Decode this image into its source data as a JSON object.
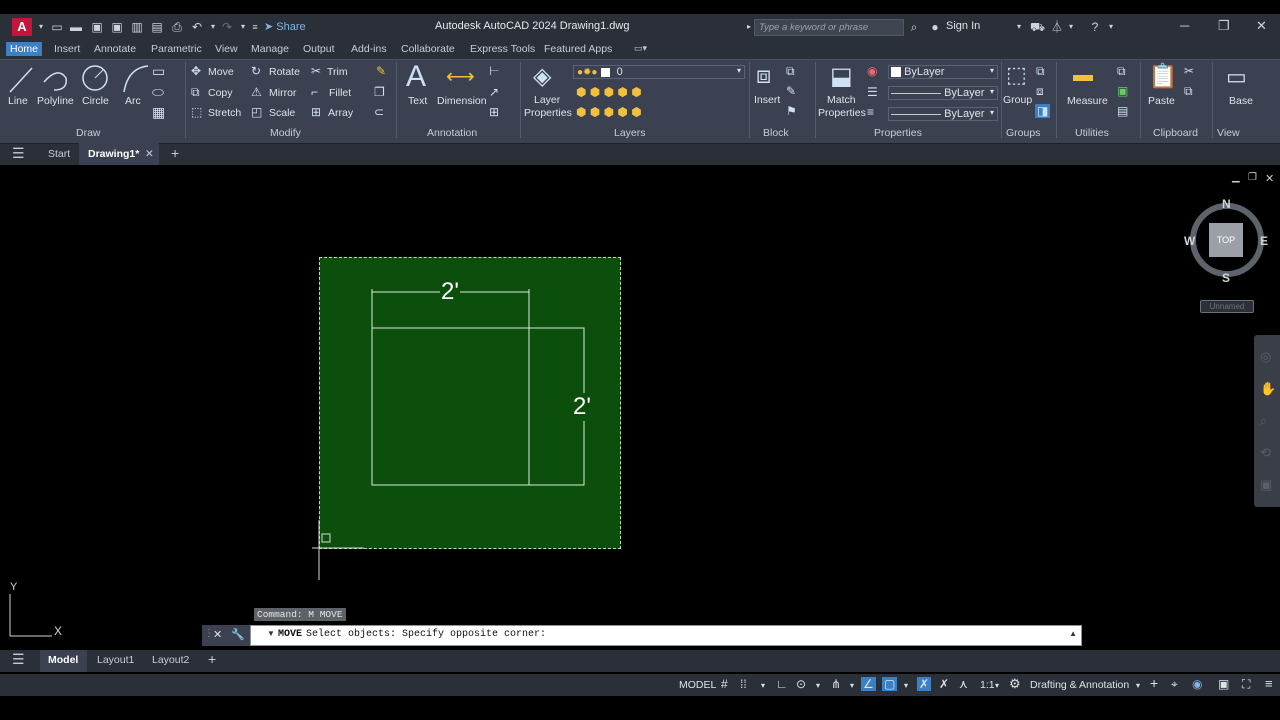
{
  "app": {
    "button_letter": "A",
    "share_label": "Share",
    "title": "Autodesk AutoCAD 2024   Drawing1.dwg",
    "search_placeholder": "Type a keyword or phrase",
    "signin_label": "Sign In"
  },
  "ribbon_tabs": [
    "Home",
    "Insert",
    "Annotate",
    "Parametric",
    "View",
    "Manage",
    "Output",
    "Add-ins",
    "Collaborate",
    "Express Tools",
    "Featured Apps"
  ],
  "draw": {
    "line": "Line",
    "polyline": "Polyline",
    "circle": "Circle",
    "arc": "Arc",
    "panel": "Draw"
  },
  "modify": {
    "move": "Move",
    "rotate": "Rotate",
    "trim": "Trim",
    "copy": "Copy",
    "mirror": "Mirror",
    "fillet": "Fillet",
    "stretch": "Stretch",
    "scale": "Scale",
    "array": "Array",
    "panel": "Modify"
  },
  "annotation": {
    "text": "Text",
    "dimension": "Dimension",
    "panel": "Annotation"
  },
  "layers": {
    "layer_properties_1": "Layer",
    "layer_properties_2": "Properties",
    "current_layer": "0",
    "panel": "Layers"
  },
  "block": {
    "insert": "Insert",
    "panel": "Block"
  },
  "properties": {
    "match_1": "Match",
    "match_2": "Properties",
    "color": "ByLayer",
    "linetype": "ByLayer",
    "lineweight": "ByLayer",
    "panel": "Properties"
  },
  "groups": {
    "group": "Group",
    "panel": "Groups"
  },
  "utilities": {
    "measure": "Measure",
    "panel": "Utilities"
  },
  "clipboard": {
    "paste": "Paste",
    "panel": "Clipboard"
  },
  "view": {
    "base": "Base",
    "panel": "View"
  },
  "doc_tabs": {
    "start": "Start",
    "drawing": "Drawing1*"
  },
  "drawing": {
    "dim_horizontal": "2'",
    "dim_vertical": "2'"
  },
  "viewcube": {
    "north": "N",
    "south": "S",
    "east": "E",
    "west": "W",
    "face": "TOP",
    "ucs": "Unnamed"
  },
  "ucs_icon": {
    "y": "Y",
    "x": "X"
  },
  "command": {
    "history": "Command: M MOVE",
    "prompt_cmd": "MOVE",
    "prompt_text": "Select objects: Specify opposite corner:"
  },
  "layouts": [
    "Model",
    "Layout1",
    "Layout2"
  ],
  "status": {
    "model": "MODEL",
    "scale": "1:1",
    "workspace": "Drafting & Annotation"
  },
  "colors": {
    "accent": "#3b7fc4",
    "app_red": "#c4163a",
    "drawing_green": "#0c4f0c"
  }
}
